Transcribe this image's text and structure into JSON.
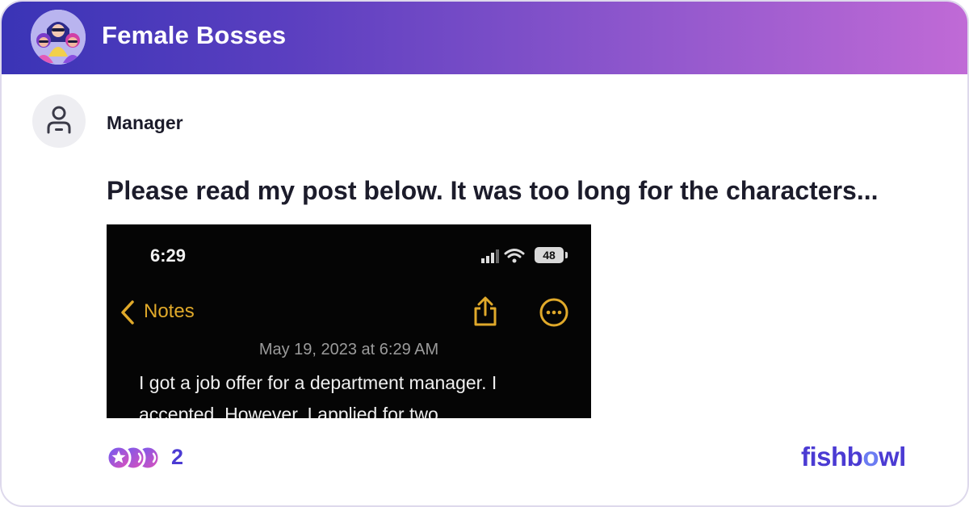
{
  "bowl": {
    "name": "Female Bosses"
  },
  "post": {
    "author_role": "Manager",
    "title": "Please read my post below. It was too long for the characters...",
    "reaction_count": "2"
  },
  "screenshot": {
    "time": "6:29",
    "battery": "48",
    "back_label": "Notes",
    "date": "May 19, 2023 at 6:29 AM",
    "lines": [
      "I got a job offer for a department manager. I",
      "accepted. However, I applied for two"
    ]
  },
  "brand": {
    "prefix": "fishb",
    "o": "o",
    "suffix": "wl"
  },
  "colors": {
    "header_gradient_start": "#3a34b6",
    "header_gradient_end": "#c06ad6",
    "brand": "#4b3bd3",
    "notes_accent": "#e0a92a"
  },
  "icons": {
    "bowl_avatar": "female-bosses-group-illustration",
    "user_avatar": "person-icon",
    "back": "chevron-left-icon",
    "share": "share-icon",
    "more": "ellipsis-circle-icon",
    "signal": "cellular-signal-icon",
    "wifi": "wifi-icon",
    "reactions": "reaction-icons"
  }
}
